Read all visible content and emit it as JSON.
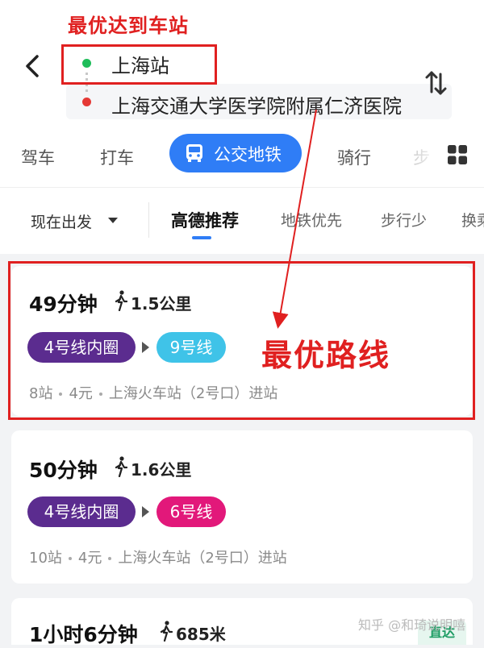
{
  "annotation": {
    "title": "最优达到车站",
    "best_route": "最优路线"
  },
  "route": {
    "origin": "上海站",
    "destination": "上海交通大学医学院附属仁济医院"
  },
  "modes": [
    {
      "label": "驾车"
    },
    {
      "label": "打车"
    },
    {
      "label": "公交地铁",
      "active": true
    },
    {
      "label": "骑行"
    },
    {
      "label": "步"
    }
  ],
  "filters": {
    "depart": "现在出发",
    "tabs": [
      {
        "label": "高德推荐",
        "active": true
      },
      {
        "label": "地铁优先"
      },
      {
        "label": "步行少"
      },
      {
        "label": "换乘"
      }
    ]
  },
  "results": [
    {
      "duration": "49分钟",
      "walk": "1.5公里",
      "lines": [
        {
          "name": "4号线内圈",
          "color": "#5b2c8f"
        },
        {
          "name": "9号线",
          "color": "#3fc3e8"
        }
      ],
      "stops": "8站",
      "fare": "4元",
      "entry": "上海火车站（2号口）进站"
    },
    {
      "duration": "50分钟",
      "walk": "1.6公里",
      "lines": [
        {
          "name": "4号线内圈",
          "color": "#5b2c8f"
        },
        {
          "name": "6号线",
          "color": "#e2187a"
        }
      ],
      "stops": "10站",
      "fare": "4元",
      "entry": "上海火车站（2号口）进站"
    },
    {
      "duration": "1小时6分钟",
      "walk": "685米",
      "badge": "直达"
    }
  ],
  "watermark": "知乎 @和琦说明嘻",
  "colors": {
    "accent": "#2f7df6",
    "annotation": "#e02020",
    "origin_dot": "#1fbd5a",
    "dest_dot": "#e53935"
  }
}
